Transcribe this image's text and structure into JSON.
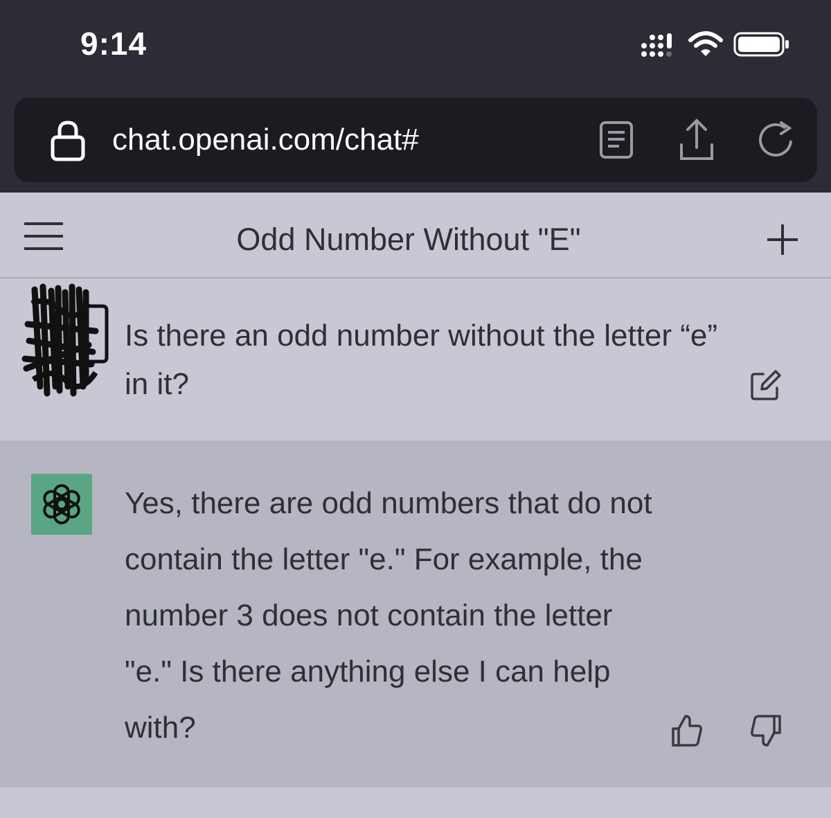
{
  "status_bar": {
    "time": "9:14",
    "icons": [
      "signal-icon",
      "wifi-icon",
      "battery-icon"
    ]
  },
  "browser": {
    "url": "chat.openai.com/chat#",
    "icons": [
      "lock-icon",
      "reader-icon",
      "share-icon",
      "reload-icon"
    ]
  },
  "nav": {
    "title": "Odd Number Without \"E\"",
    "icons": [
      "menu-icon",
      "plus-icon"
    ]
  },
  "messages": [
    {
      "role": "user",
      "text": "Is there an odd number without the letter “e” in it?"
    },
    {
      "role": "assistant",
      "text": "Yes, there are odd numbers that do not contain the letter \"e.\" For example, the number 3 does not contain the letter \"e.\" Is there anything else I can help with?"
    }
  ],
  "colors": {
    "status_bg": "#2c2c36",
    "url_bg": "#1b1b22",
    "page_bg": "#c8c8d4",
    "assistant_bg": "#b5b6c2",
    "logo_bg": "#5aa583",
    "text": "#2f2f37"
  }
}
